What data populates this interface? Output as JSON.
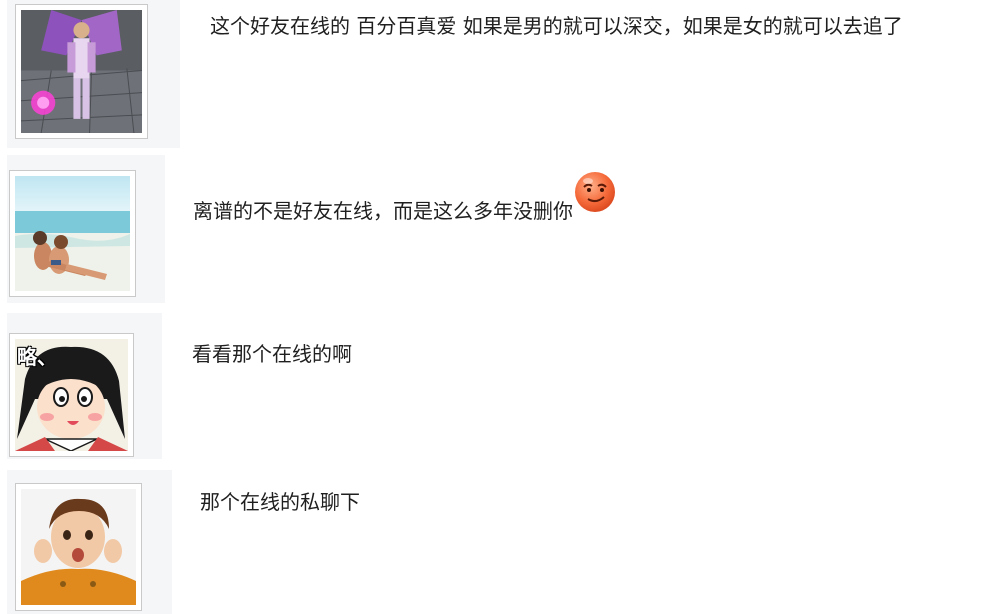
{
  "comments": [
    {
      "text": "这个好友在线的 百分百真爱 如果是男的就可以深交，如果是女的就可以去追了",
      "avatar": "game-character-avatar"
    },
    {
      "text": "离谱的不是好友在线，而是这么多年没删你",
      "avatar": "beach-couple-avatar",
      "emoji": "smirk-face-emoji"
    },
    {
      "text": "看看那个在线的啊",
      "avatar": "cartoon-girl-avatar",
      "avatar_caption": "略、"
    },
    {
      "text": "那个在线的私聊下",
      "avatar": "child-photo-avatar"
    }
  ]
}
